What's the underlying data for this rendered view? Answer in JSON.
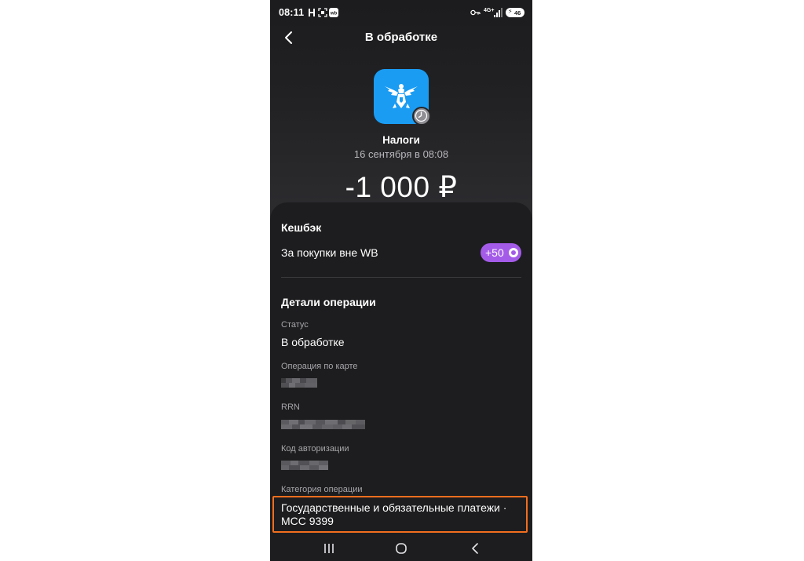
{
  "status_bar": {
    "time": "08:11",
    "network": "4G+",
    "battery": "46",
    "icons": [
      "signal-h-icon",
      "screenshot-icon",
      "wb-app-icon",
      "key-icon",
      "signal-bars-icon",
      "battery-icon"
    ]
  },
  "header": {
    "title": "В обработке",
    "back_icon": "chevron-left-icon"
  },
  "merchant": {
    "name": "Налоги",
    "date": "16 сентября в 08:08",
    "icon": "russian-eagle-emblem-icon",
    "badge_icon": "clock-icon",
    "icon_color": "#1a9cf3"
  },
  "amount": "-1 000 ₽",
  "cashback": {
    "title": "Кешбэк",
    "row_label": "За покупки вне WB",
    "value": "+50",
    "pill_color": "#a45ce8"
  },
  "details": {
    "title": "Детали операции",
    "status_label": "Статус",
    "status_value": "В обработке",
    "card_label": "Операция по карте",
    "rrn_label": "RRN",
    "auth_label": "Код авторизации",
    "category_label": "Категория операции",
    "category_value_line1": "Государственные и обязательные платежи ·",
    "category_value_line2": "MCC 9399"
  },
  "highlight_color": "#f26e1f",
  "nav": {
    "recent_icon": "recent-apps-icon",
    "home_icon": "home-circle-icon",
    "back_icon": "nav-back-icon"
  }
}
